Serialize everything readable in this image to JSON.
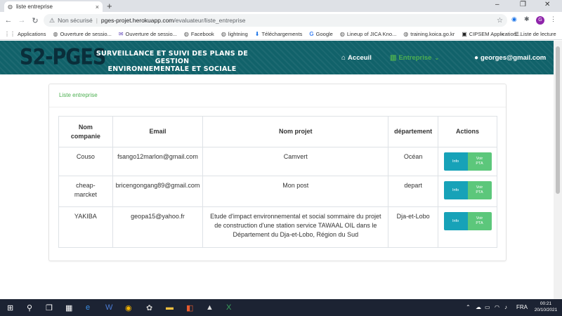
{
  "browser": {
    "tab_title": "liste entreprise",
    "tab_close": "×",
    "new_tab": "+",
    "window_controls": {
      "minimize": "–",
      "restore": "❐",
      "close": "✕"
    },
    "security_label": "Non sécurisé",
    "url_host": "pges-projet.herokuapp.com",
    "url_path": "/evaluateur/liste_entreprise",
    "profile_initial": "G",
    "bookmarks": [
      {
        "icon": "apps-icon",
        "glyph": "⋮⋮",
        "label": "Applications"
      },
      {
        "icon": "globe-icon",
        "glyph": "◍",
        "label": "Ouverture de sessio..."
      },
      {
        "icon": "mail-icon",
        "glyph": "✉",
        "label": "Ouverture de sessio..."
      },
      {
        "icon": "globe-icon",
        "glyph": "◍",
        "label": "Facebook"
      },
      {
        "icon": "globe-icon",
        "glyph": "◍",
        "label": "lightning"
      },
      {
        "icon": "download-icon",
        "glyph": "⬇",
        "label": "Téléchargements"
      },
      {
        "icon": "google-icon",
        "glyph": "G",
        "label": "Google"
      },
      {
        "icon": "globe-icon",
        "glyph": "◍",
        "label": "Lineup of JICA Kno..."
      },
      {
        "icon": "globe-icon",
        "glyph": "◍",
        "label": "training.koica.go.kr"
      },
      {
        "icon": "site-icon",
        "glyph": "▣",
        "label": "CIPSEM Application..."
      }
    ],
    "bookmarks_more": "»",
    "reading_list": "Liste de lecture"
  },
  "header": {
    "logo_mark": "S2-PGES",
    "logo_line1": "SURVEILLANCE ET SUIVI DES PLANS DE GESTION",
    "logo_line2": "ENVIRONNEMENTALE ET SOCIALE",
    "nav_home": "Acceuil",
    "nav_company": "Entreprise",
    "nav_company_caret": "⌄",
    "user_email": "georges@gmail.com"
  },
  "card": {
    "title": "Liste entreprise"
  },
  "table": {
    "headers": {
      "company_line1": "Nom",
      "company_line2": "companie",
      "email": "Email",
      "project": "Nom projet",
      "department": "département",
      "actions": "Actions"
    },
    "rows": [
      {
        "company": "Couso",
        "email": "fsango12marlon@gmail.com",
        "project": "Camvert",
        "department": "Océan"
      },
      {
        "company": "cheap-\nmarcket",
        "email": "bricengongang89@gmail.com",
        "project": "Mon post",
        "department": "depart"
      },
      {
        "company": "YAKIBA",
        "email": "geopa15@yahoo.fr",
        "project": "Etude d'impact environnemental et social sommaire du projet de construction d'une station service TAWAAL OIL dans le Département du Dja-et-Lobo, Région du Sud",
        "department": "Dja-et-Lobo"
      }
    ],
    "btn_info": "Info",
    "btn_pta_line1": "Voir",
    "btn_pta_line2": "PTA"
  },
  "taskbar": {
    "language": "FRA",
    "time": "00:21",
    "date": "20/10/2021"
  },
  "colors": {
    "header_bg": "#11626a",
    "active_nav": "#4caf50",
    "info_btn": "#17a2b8",
    "pta_btn": "#5cc77b"
  }
}
